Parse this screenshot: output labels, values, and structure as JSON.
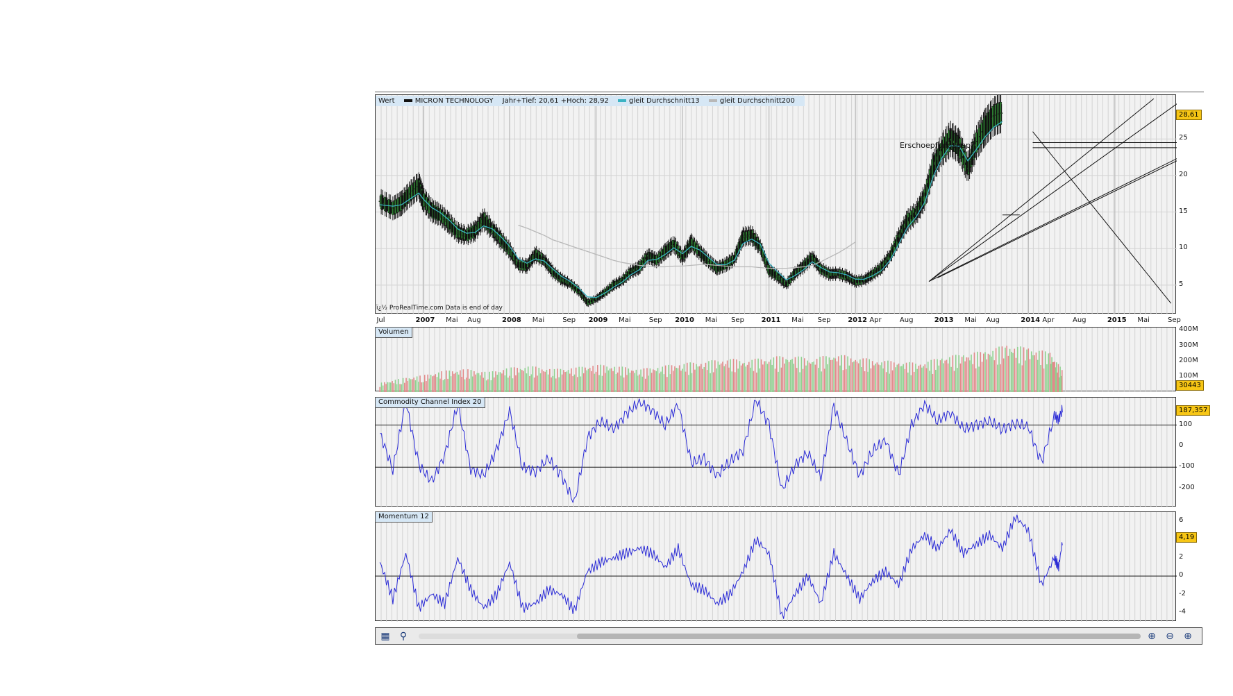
{
  "chart_data": [
    {
      "type": "candlestick",
      "title": "MICRON TECHNOLOGY",
      "legend": {
        "label": "Wert",
        "items": [
          {
            "name": "MICRON TECHNOLOGY",
            "color": "#111111"
          },
          {
            "name": "Jahr+Tief: 20,61 +Hoch: 28,92",
            "color": ""
          },
          {
            "name": "gleit Durchschnitt13",
            "color": "#3bb3c3"
          },
          {
            "name": "gleit Durchschnitt200",
            "color": "#b8b8b8"
          }
        ]
      },
      "last_value": "28,61",
      "ylim": [
        1,
        31
      ],
      "yticks": [
        5,
        10,
        15,
        20,
        25
      ],
      "x_axis_labels": [
        "Jul",
        "2007",
        "Mai",
        "Aug",
        "2008",
        "Mai",
        "Sep",
        "2009",
        "Mai",
        "Sep",
        "2010",
        "Mai",
        "Sep",
        "2011",
        "Mai",
        "Sep",
        "2012",
        "Apr",
        "Aug",
        "2013",
        "Mai",
        "Aug",
        "2014",
        "Apr",
        "Aug",
        "2015",
        "Mai",
        "Sep"
      ],
      "x": [
        2006.5,
        2006.65,
        2006.75,
        2006.85,
        2006.95,
        2007.0,
        2007.1,
        2007.2,
        2007.3,
        2007.4,
        2007.5,
        2007.6,
        2007.7,
        2007.8,
        2007.9,
        2008.0,
        2008.1,
        2008.2,
        2008.3,
        2008.4,
        2008.5,
        2008.6,
        2008.7,
        2008.8,
        2008.9,
        2009.0,
        2009.1,
        2009.2,
        2009.3,
        2009.4,
        2009.5,
        2009.6,
        2009.7,
        2009.8,
        2009.9,
        2010.0,
        2010.1,
        2010.2,
        2010.3,
        2010.4,
        2010.5,
        2010.6,
        2010.7,
        2010.8,
        2010.9,
        2011.0,
        2011.1,
        2011.2,
        2011.3,
        2011.4,
        2011.5,
        2011.6,
        2011.7,
        2011.8,
        2011.9,
        2012.0,
        2012.1,
        2012.2,
        2012.3,
        2012.4,
        2012.5,
        2012.6,
        2012.7,
        2012.8,
        2012.9,
        2013.0,
        2013.1,
        2013.2,
        2013.3,
        2013.4,
        2013.5,
        2013.6,
        2013.7,
        2013.8,
        2013.9,
        2014.0,
        2014.1,
        2014.2,
        2014.3,
        2014.35,
        2014.4
      ],
      "series": [
        {
          "name": "MICRON TECHNOLOGY",
          "values": [
            16.5,
            15.5,
            16.2,
            17.5,
            18.6,
            16.8,
            15.2,
            14.6,
            13.5,
            12.2,
            11.8,
            12.4,
            14.0,
            12.6,
            11.2,
            9.8,
            7.8,
            7.6,
            9.2,
            8.4,
            6.8,
            5.8,
            5.2,
            4.2,
            2.6,
            3.1,
            4.0,
            5.0,
            5.6,
            6.8,
            7.4,
            9.0,
            8.4,
            9.6,
            10.6,
            8.8,
            10.8,
            9.5,
            8.3,
            7.3,
            7.8,
            8.6,
            11.6,
            11.8,
            10.2,
            7.0,
            6.2,
            5.1,
            6.6,
            7.6,
            8.8,
            7.2,
            6.5,
            6.6,
            6.2,
            5.5,
            5.7,
            6.5,
            7.4,
            9.0,
            11.5,
            13.8,
            14.8,
            17.0,
            21.2,
            23.5,
            25.0,
            24.0,
            21.0,
            24.5,
            26.6,
            28.1,
            28.6,
            28.6,
            28.6,
            28.6,
            28.6,
            28.6,
            28.6,
            28.6,
            28.6
          ]
        },
        {
          "name": "gleit Durchschnitt13",
          "values": [
            16.0,
            15.8,
            16.0,
            16.8,
            17.6,
            16.8,
            15.6,
            14.9,
            13.9,
            12.7,
            12.1,
            12.2,
            13.1,
            12.7,
            11.6,
            10.3,
            8.6,
            8.0,
            8.6,
            8.3,
            7.2,
            6.2,
            5.5,
            4.6,
            3.4,
            3.3,
            3.9,
            4.7,
            5.4,
            6.4,
            7.1,
            8.4,
            8.5,
            9.2,
            10.1,
            9.3,
            10.3,
            9.8,
            8.8,
            7.8,
            7.8,
            8.4,
            10.7,
            11.3,
            10.6,
            8.0,
            6.8,
            5.7,
            6.3,
            7.1,
            8.2,
            7.4,
            6.8,
            6.7,
            6.4,
            5.8,
            5.8,
            6.3,
            7.0,
            8.4,
            10.6,
            12.9,
            14.3,
            16.3,
            19.9,
            22.4,
            24.1,
            24.0,
            22.0,
            23.6,
            25.3,
            26.6,
            27.4,
            27.4,
            27.4,
            27.4,
            27.4,
            27.4,
            27.4,
            27.4,
            27.4
          ]
        },
        {
          "name": "gleit Durchschnitt200",
          "values": [
            null,
            null,
            null,
            null,
            null,
            null,
            null,
            null,
            null,
            null,
            null,
            null,
            null,
            null,
            null,
            null,
            13.2,
            12.8,
            12.3,
            11.8,
            11.2,
            10.8,
            10.4,
            10.0,
            9.6,
            9.2,
            8.8,
            8.4,
            8.1,
            7.9,
            7.7,
            7.6,
            7.5,
            7.5,
            7.6,
            7.6,
            7.7,
            7.8,
            7.8,
            7.7,
            7.6,
            7.5,
            7.5,
            7.5,
            7.4,
            7.3,
            7.3,
            7.3,
            7.4,
            7.5,
            7.7,
            8.2,
            8.8,
            9.4,
            10.1,
            10.9,
            null,
            null,
            null,
            null,
            null,
            null,
            null,
            null,
            null,
            null,
            null,
            null,
            null,
            null,
            null,
            null,
            null,
            null,
            null,
            null,
            null,
            null,
            null,
            null,
            null
          ]
        }
      ],
      "annotations": [
        "Erschoepfungsgap?"
      ],
      "credit": "ï¿½ ProRealTime.com  Data is end of day"
    },
    {
      "type": "bar",
      "title": "Volumen",
      "last_value": "30443",
      "yticks": [
        "400M",
        "300M",
        "200M",
        "100M"
      ],
      "ylim": [
        0,
        420
      ],
      "x": [
        2006.5,
        2006.75,
        2007.0,
        2007.25,
        2007.5,
        2007.75,
        2008.0,
        2008.25,
        2008.5,
        2008.75,
        2009.0,
        2009.25,
        2009.5,
        2009.75,
        2010.0,
        2010.25,
        2010.5,
        2010.75,
        2011.0,
        2011.25,
        2011.5,
        2011.75,
        2012.0,
        2012.25,
        2012.5,
        2012.75,
        2013.0,
        2013.25,
        2013.5,
        2013.75,
        2014.0,
        2014.25,
        2014.4
      ],
      "values": [
        60,
        90,
        110,
        140,
        150,
        130,
        160,
        170,
        150,
        160,
        180,
        170,
        150,
        170,
        190,
        200,
        220,
        210,
        230,
        240,
        220,
        250,
        230,
        210,
        200,
        190,
        230,
        250,
        270,
        310,
        290,
        260,
        140
      ]
    },
    {
      "type": "line",
      "title": "Commodity Channel Index 20",
      "last_value": "187,357",
      "yticks": [
        100,
        0,
        -100,
        -200
      ],
      "ylim": [
        -290,
        230
      ],
      "x": [
        2006.5,
        2006.65,
        2006.8,
        2006.95,
        2007.1,
        2007.25,
        2007.4,
        2007.55,
        2007.7,
        2007.85,
        2008.0,
        2008.15,
        2008.3,
        2008.45,
        2008.6,
        2008.75,
        2008.9,
        2009.05,
        2009.2,
        2009.35,
        2009.5,
        2009.65,
        2009.8,
        2009.95,
        2010.1,
        2010.25,
        2010.4,
        2010.55,
        2010.7,
        2010.85,
        2011.0,
        2011.15,
        2011.3,
        2011.45,
        2011.6,
        2011.75,
        2011.9,
        2012.05,
        2012.2,
        2012.35,
        2012.5,
        2012.65,
        2012.8,
        2012.95,
        2013.1,
        2013.25,
        2013.4,
        2013.55,
        2013.7,
        2013.85,
        2014.0,
        2014.15,
        2014.3,
        2014.35,
        2014.4
      ],
      "values": [
        60,
        -110,
        210,
        -90,
        -170,
        -40,
        200,
        -110,
        -140,
        -20,
        170,
        -100,
        -120,
        -60,
        -140,
        -270,
        40,
        120,
        80,
        150,
        210,
        170,
        100,
        200,
        -80,
        -60,
        -140,
        -70,
        -20,
        220,
        100,
        -210,
        -90,
        -30,
        -150,
        190,
        20,
        -140,
        -20,
        30,
        -140,
        100,
        200,
        120,
        160,
        80,
        100,
        120,
        80,
        110,
        90,
        -80,
        140,
        130,
        180
      ]
    },
    {
      "type": "line",
      "title": "Momentum 12",
      "last_value": "4,19",
      "yticks": [
        6,
        2,
        0,
        -2,
        -4
      ],
      "ylim": [
        -5,
        7
      ],
      "x": [
        2006.5,
        2006.65,
        2006.8,
        2006.95,
        2007.1,
        2007.25,
        2007.4,
        2007.55,
        2007.7,
        2007.85,
        2008.0,
        2008.15,
        2008.3,
        2008.45,
        2008.6,
        2008.75,
        2008.9,
        2009.05,
        2009.2,
        2009.35,
        2009.5,
        2009.65,
        2009.8,
        2009.95,
        2010.1,
        2010.25,
        2010.4,
        2010.55,
        2010.7,
        2010.85,
        2011.0,
        2011.15,
        2011.3,
        2011.45,
        2011.6,
        2011.75,
        2011.9,
        2012.05,
        2012.2,
        2012.35,
        2012.5,
        2012.65,
        2012.8,
        2012.95,
        2013.1,
        2013.25,
        2013.4,
        2013.55,
        2013.7,
        2013.85,
        2014.0,
        2014.15,
        2014.3,
        2014.35,
        2014.4
      ],
      "values": [
        1.5,
        -2.5,
        2.5,
        -3.5,
        -2.0,
        -3.0,
        2.0,
        -1.5,
        -3.5,
        -2.0,
        1.5,
        -3.5,
        -3.0,
        -1.5,
        -2.0,
        -3.8,
        0.5,
        1.5,
        2.0,
        2.5,
        3.0,
        2.5,
        1.0,
        3.0,
        -1.0,
        -1.5,
        -3.0,
        -2.0,
        0.5,
        4.0,
        2.5,
        -4.5,
        -2.0,
        0.0,
        -3.0,
        2.5,
        0.0,
        -2.5,
        -0.5,
        0.5,
        -1.0,
        3.0,
        4.5,
        3.0,
        5.0,
        2.5,
        3.5,
        4.5,
        3.0,
        6.5,
        5.0,
        -1.0,
        2.0,
        1.0,
        4.2
      ]
    }
  ],
  "footer": {
    "icons": [
      "chart-settings-icon",
      "indicator-icon",
      "zoom-fit-icon",
      "zoom-out-icon",
      "zoom-in-icon"
    ]
  }
}
